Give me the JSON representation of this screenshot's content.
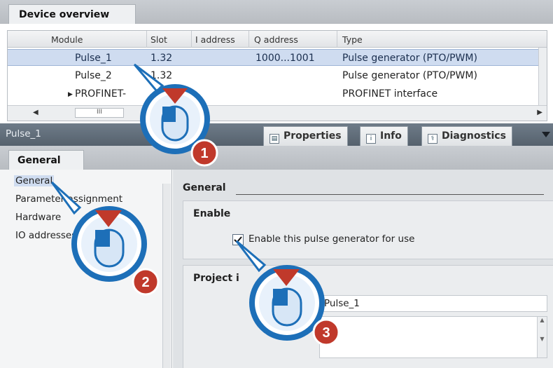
{
  "device_overview": {
    "tab_label": "Device overview",
    "columns": [
      "Module",
      "Slot",
      "I address",
      "Q address",
      "Type"
    ],
    "rows": [
      {
        "module": "Pulse_1",
        "slot": "1.32",
        "i_address": "",
        "q_address": "1000...1001",
        "type": "Pulse generator (PTO/PWM)"
      },
      {
        "module": "Pulse_2",
        "slot": "1.32",
        "i_address": "",
        "q_address": "",
        "type": "Pulse generator (PTO/PWM)"
      },
      {
        "module": "PROFINET-",
        "slot": "",
        "i_address": "",
        "q_address": "",
        "type": "PROFINET interface"
      }
    ],
    "scroll_thumb_label": "III"
  },
  "inspector": {
    "title": "Pulse_1",
    "tabs": [
      {
        "label": "Properties",
        "icon": "properties-icon"
      },
      {
        "label": "Info",
        "icon": "info-icon"
      },
      {
        "label": "Diagnostics",
        "icon": "diagnostics-icon"
      }
    ],
    "sub_tab": "General"
  },
  "nav": {
    "items": [
      "General",
      "Parameter assignment",
      "Hardware",
      "IO addresses"
    ]
  },
  "main": {
    "heading": "General",
    "enable": {
      "title": "Enable",
      "checkbox_label": "Enable this pulse generator for use",
      "checked": true
    },
    "project_info": {
      "title": "Project i",
      "name_value": "Pulse_1"
    }
  },
  "callouts": [
    "1",
    "2",
    "3"
  ],
  "colors": {
    "callout_red": "#c0392b",
    "callout_blue": "#1d6fb8",
    "selection": "#cfdcf0"
  }
}
